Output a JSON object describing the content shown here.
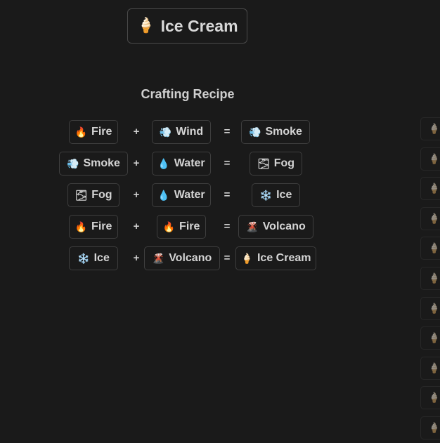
{
  "header": {
    "icon": "ice-cream-icon",
    "emoji": "🍦",
    "title": "Ice Cream"
  },
  "section_title": "Crafting Recipe",
  "operators": {
    "plus": "+",
    "equals": "="
  },
  "recipes": [
    {
      "a": {
        "emoji": "🔥",
        "icon": "fire-icon",
        "label": "Fire"
      },
      "b": {
        "emoji": "💨",
        "icon": "wind-icon",
        "label": "Wind"
      },
      "result": {
        "emoji": "💨",
        "icon": "smoke-icon",
        "label": "Smoke"
      }
    },
    {
      "a": {
        "emoji": "💨",
        "icon": "smoke-icon",
        "label": "Smoke"
      },
      "b": {
        "emoji": "💧",
        "icon": "water-icon",
        "label": "Water"
      },
      "result": {
        "emoji": "🌫",
        "icon": "fog-icon",
        "label": "Fog"
      }
    },
    {
      "a": {
        "emoji": "🌫",
        "icon": "fog-icon",
        "label": "Fog"
      },
      "b": {
        "emoji": "💧",
        "icon": "water-icon",
        "label": "Water"
      },
      "result": {
        "emoji": "❄️",
        "icon": "snowflake-icon",
        "label": "Ice"
      }
    },
    {
      "a": {
        "emoji": "🔥",
        "icon": "fire-icon",
        "label": "Fire"
      },
      "b": {
        "emoji": "🔥",
        "icon": "fire-icon",
        "label": "Fire"
      },
      "result": {
        "emoji": "🌋",
        "icon": "volcano-icon",
        "label": "Volcano"
      }
    },
    {
      "a": {
        "emoji": "❄️",
        "icon": "snowflake-icon",
        "label": "Ice"
      },
      "b": {
        "emoji": "🌋",
        "icon": "volcano-icon",
        "label": "Volcano"
      },
      "result": {
        "emoji": "🍦",
        "icon": "ice-cream-icon",
        "label": "Ice Cream"
      }
    }
  ],
  "side_items": [
    {
      "emoji": "🍦",
      "icon": "ice-cream-icon"
    },
    {
      "emoji": "🍦",
      "icon": "ice-cream-icon"
    },
    {
      "emoji": "🍦",
      "icon": "ice-cream-icon"
    },
    {
      "emoji": "🍦",
      "icon": "ice-cream-icon"
    },
    {
      "emoji": "🍦",
      "icon": "ice-cream-icon"
    },
    {
      "emoji": "🍦",
      "icon": "ice-cream-icon"
    },
    {
      "emoji": "🍦",
      "icon": "ice-cream-icon"
    },
    {
      "emoji": "🍦",
      "icon": "ice-cream-icon"
    },
    {
      "emoji": "🍦",
      "icon": "ice-cream-icon"
    },
    {
      "emoji": "🍦",
      "icon": "ice-cream-icon"
    },
    {
      "emoji": "🍦",
      "icon": "ice-cream-icon"
    }
  ]
}
